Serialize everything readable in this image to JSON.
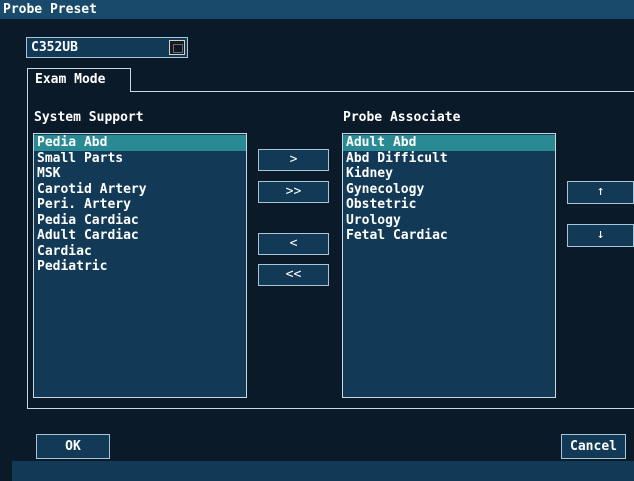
{
  "window": {
    "title": "Probe Preset"
  },
  "preset": {
    "selected": "C352UB"
  },
  "tab": {
    "label": "Exam Mode"
  },
  "system_support": {
    "label": "System Support",
    "items": [
      "Pedia Abd",
      "Small Parts",
      "MSK",
      "Carotid Artery",
      "Peri. Artery",
      "Pedia Cardiac",
      "Adult Cardiac",
      "Cardiac",
      "Pediatric"
    ],
    "selected_index": 0
  },
  "probe_associate": {
    "label": "Probe Associate",
    "items": [
      "Adult Abd",
      "Abd Difficult",
      "Kidney",
      "Gynecology",
      "Obstetric",
      "Urology",
      "Fetal Cardiac"
    ],
    "selected_index": 0
  },
  "transfer_buttons": {
    "add": ">",
    "add_all": ">>",
    "remove": "<",
    "remove_all": "<<"
  },
  "order_buttons": {
    "up": "↑",
    "down": "↓"
  },
  "footer": {
    "ok": "OK",
    "cancel": "Cancel"
  },
  "colors": {
    "background": "#0b1a29",
    "titlebar": "#1a4a6b",
    "list_bg": "#123a57",
    "selection": "#2a8a94"
  }
}
